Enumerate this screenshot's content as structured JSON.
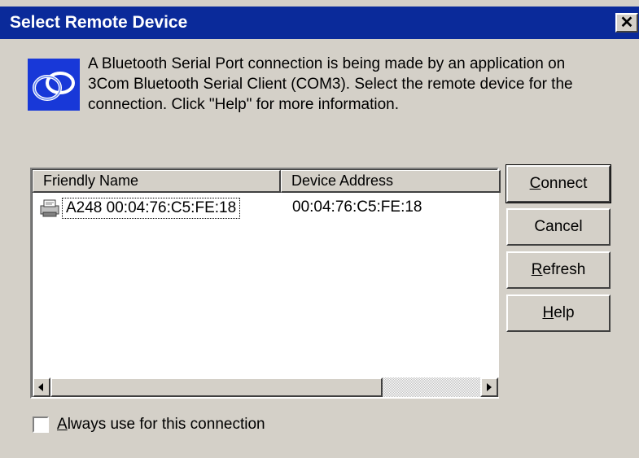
{
  "window": {
    "title": "Select Remote Device",
    "close_label": "✕"
  },
  "message": {
    "line1": "A Bluetooth Serial Port connection is being made by an application on",
    "line2": "3Com Bluetooth Serial Client (COM3).  Select the remote device for the",
    "line3": "connection.  Click \"Help\" for more information."
  },
  "list": {
    "columns": [
      "Friendly Name",
      "Device Address"
    ],
    "rows": [
      {
        "friendly_name": "A248 00:04:76:C5:FE:18",
        "device_address": "00:04:76:C5:FE:18",
        "icon": "printer-icon"
      }
    ]
  },
  "buttons": {
    "connect": {
      "first": "C",
      "rest": "onnect"
    },
    "cancel": "Cancel",
    "refresh": {
      "first": "R",
      "rest": "efresh"
    },
    "help": {
      "first": "H",
      "rest": "elp"
    }
  },
  "checkbox": {
    "first": "A",
    "rest": "lways use for this connection",
    "checked": false
  },
  "icons": {
    "logo": "bluetooth-logo-icon",
    "close": "close-icon"
  },
  "colors": {
    "titlebar": "#0a2a9a",
    "face": "#d4d0c8"
  }
}
